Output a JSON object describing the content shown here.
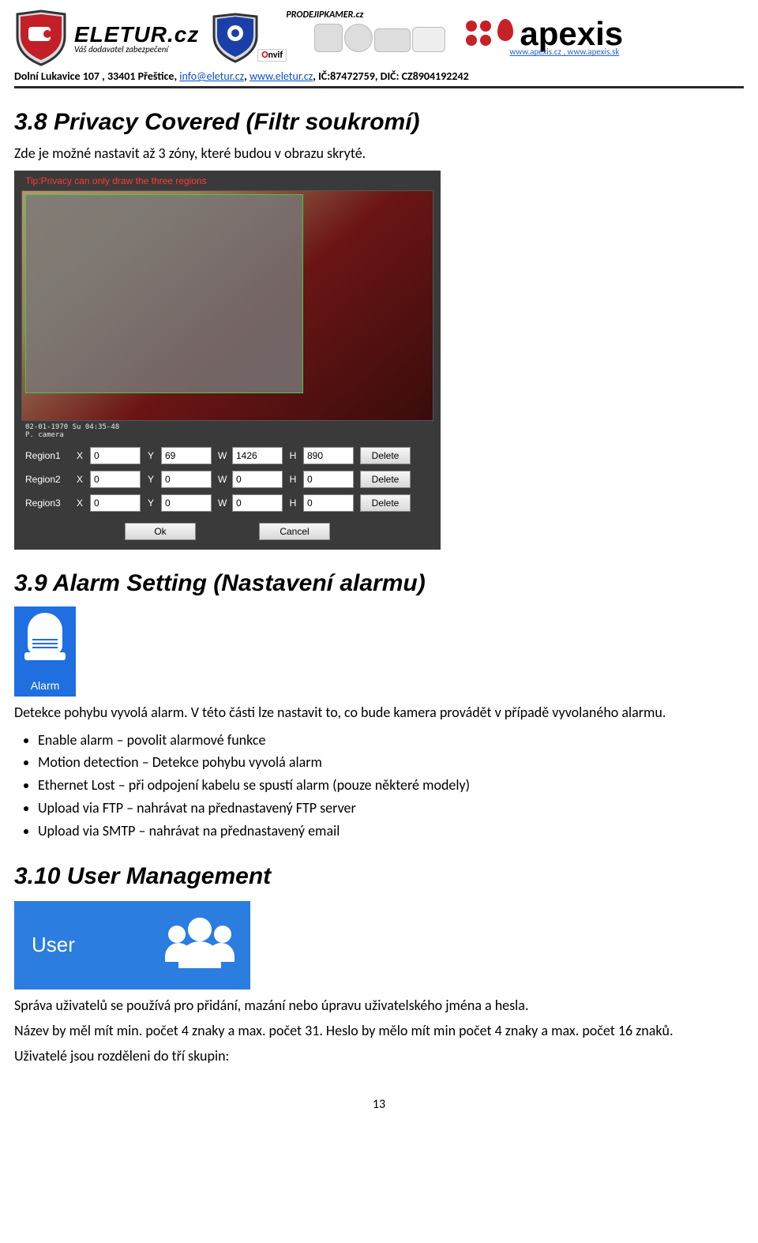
{
  "header": {
    "brand_main": "ELETUR.cz",
    "brand_sub": "Váš dodavatel zabezpečení",
    "prodej": "PRODEJIPKAMER.cz",
    "onvif": "Onvif",
    "apex_name": "apexis",
    "apex_sub": "www.apexis.cz , www.apexis.sk",
    "info_prefix": "Dolní Lukavice 107 , 33401 Přeštice, ",
    "info_email": "info@eletur.cz",
    "info_sep1": ", ",
    "info_www": "www.eletur.cz",
    "info_tail": ",  IČ:87472759,    DIČ: CZ8904192242"
  },
  "s38": {
    "title": "3.8  Privacy Covered (Filtr soukromí)",
    "p": "Zde je možné nastavit až 3 zóny, které budou v obrazu skryté."
  },
  "priv": {
    "tip": "Tip:Privacy can only draw the three regions",
    "meta_line1": "02-01-1970 Su 04:35-48",
    "meta_line2": "P. camera",
    "labels": {
      "x": "X",
      "y": "Y",
      "w": "W",
      "h": "H"
    },
    "rows": [
      {
        "name": "Region1",
        "x": "0",
        "y": "69",
        "w": "1426",
        "h": "890"
      },
      {
        "name": "Region2",
        "x": "0",
        "y": "0",
        "w": "0",
        "h": "0"
      },
      {
        "name": "Region3",
        "x": "0",
        "y": "0",
        "w": "0",
        "h": "0"
      }
    ],
    "delete": "Delete",
    "ok": "Ok",
    "cancel": "Cancel"
  },
  "s39": {
    "title": "3.9  Alarm Setting (Nastavení alarmu)",
    "tile": "Alarm",
    "p": "Detekce pohybu vyvolá alarm.  V této části lze nastavit to, co bude kamera provádět v případě vyvolaného alarmu.",
    "bullets": [
      "Enable alarm – povolit alarmové funkce",
      "Motion detection – Detekce pohybu vyvolá alarm",
      "Ethernet Lost – při odpojení kabelu se spustí alarm (pouze některé modely)",
      "Upload via FTP – nahrávat na přednastavený FTP server",
      "Upload via SMTP – nahrávat na přednastavený email"
    ]
  },
  "s310": {
    "title": "3.10 User Management",
    "tile": "User",
    "p1": "Správa uživatelů se používá pro přidání, mazání nebo úpravu uživatelského jména a hesla.",
    "p2": "Název by měl mít min. počet 4 znaky a max. počet 31. Heslo by mělo mít min počet 4 znaky a max. počet 16 znaků.",
    "p3": "Uživatelé jsou rozděleni do tří skupin:"
  },
  "page_number": "13"
}
